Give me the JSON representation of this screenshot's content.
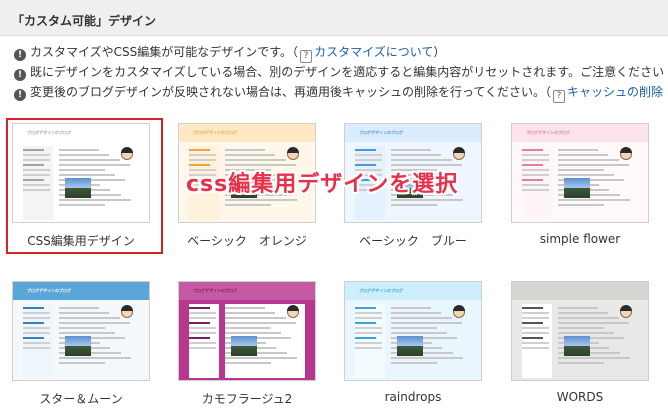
{
  "header": {
    "title": "「カスタム可能」デザイン"
  },
  "notes": [
    {
      "text": "カスタマイズやCSS編集が可能なデザインです。（",
      "link": "カスタマイズについて",
      "after": "）"
    },
    {
      "text": "既にデザインをカスタマイズしている場合、別のデザインを適応すると編集内容がリセットされます。ご注意ください",
      "link": "",
      "after": ""
    },
    {
      "text": "変更後のブログデザインが反映されない場合は、再適用後キャッシュの削除を行ってください。（",
      "link": "キャッシュの削除",
      "after": ""
    }
  ],
  "icons": {
    "info": "info-icon",
    "help": "help-icon"
  },
  "designs": [
    {
      "label": "CSS編集用デザイン",
      "selected": true,
      "theme": "white",
      "blog_title": "ブログデザインのブログ"
    },
    {
      "label": "ベーシック　オレンジ",
      "selected": false,
      "theme": "orange",
      "blog_title": "ブログデザインのブログ"
    },
    {
      "label": "ベーシック　ブルー",
      "selected": false,
      "theme": "blue",
      "blog_title": "ブログデザインのブログ"
    },
    {
      "label": "simple flower",
      "selected": false,
      "theme": "flower",
      "blog_title": "ブログデザインのブログ"
    },
    {
      "label": "スター＆ムーン",
      "selected": false,
      "theme": "star",
      "blog_title": "ブログデザインのブログ"
    },
    {
      "label": "カモフラージュ2",
      "selected": false,
      "theme": "camo",
      "blog_title": "ブログデザインのブログ"
    },
    {
      "label": "raindrops",
      "selected": false,
      "theme": "rain",
      "blog_title": "ブログデザインのブログ"
    },
    {
      "label": "WORDS",
      "selected": false,
      "theme": "words",
      "blog_title": ""
    }
  ],
  "annotation": {
    "text": "css編集用デザインを選択",
    "color": "#e8304a"
  },
  "colors": {
    "selection_border": "#d4242a",
    "link": "#1a5fa8",
    "header_bg": "#efefef"
  }
}
